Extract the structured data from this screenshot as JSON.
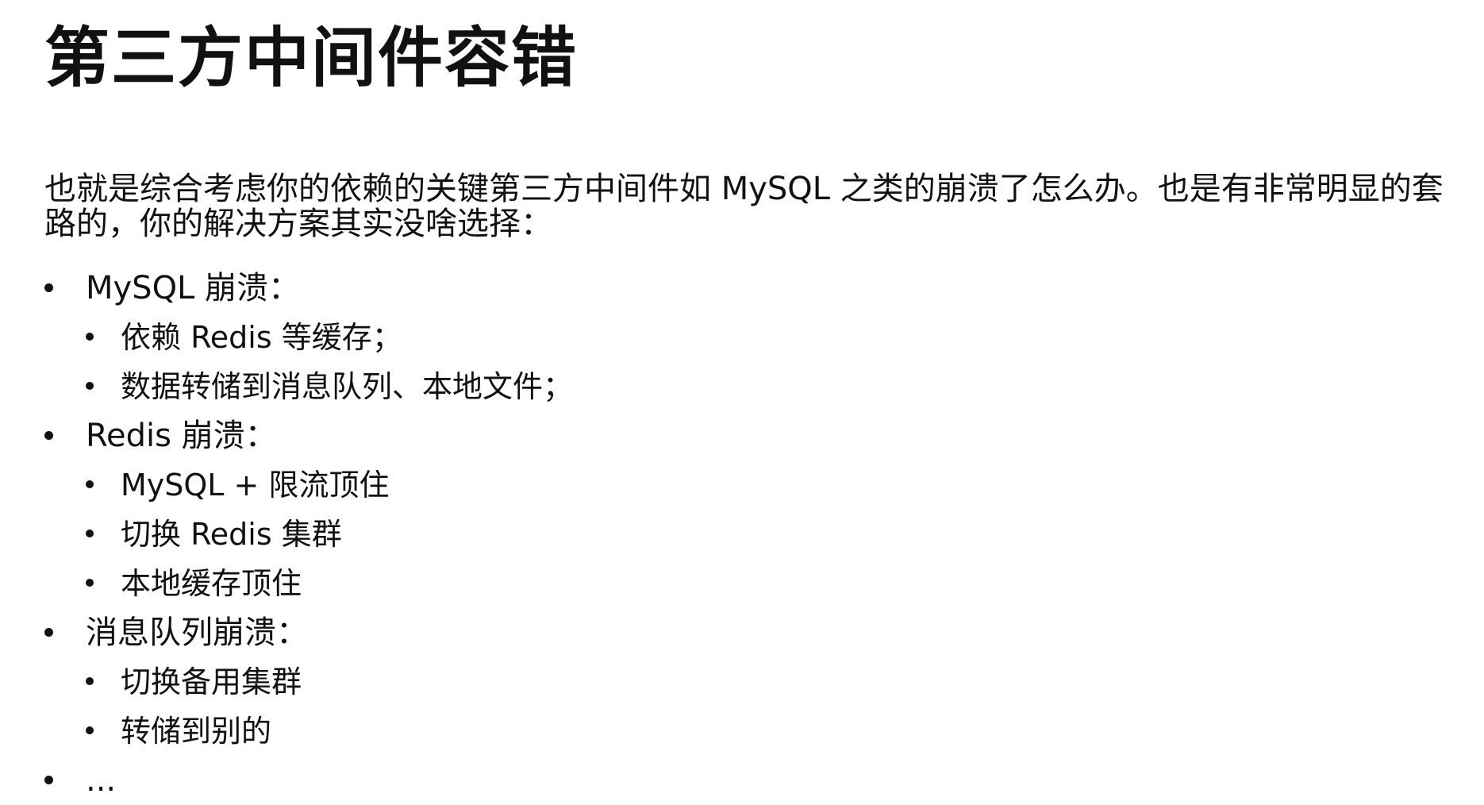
{
  "title": "第三方中间件容错",
  "intro": "也就是综合考虑你的依赖的关键第三方中间件如 MySQL 之类的崩溃了怎么办。也是有非常明显的套路的，你的解决方案其实没啥选择：",
  "items": [
    {
      "label": "MySQL 崩溃：",
      "subitems": [
        "依赖 Redis 等缓存；",
        "数据转储到消息队列、本地文件；"
      ]
    },
    {
      "label": "Redis 崩溃：",
      "subitems": [
        "MySQL + 限流顶住",
        "切换 Redis 集群",
        "本地缓存顶住"
      ]
    },
    {
      "label": "消息队列崩溃：",
      "subitems": [
        "切换备用集群",
        "转储到别的"
      ]
    },
    {
      "label": "...",
      "subitems": []
    }
  ]
}
